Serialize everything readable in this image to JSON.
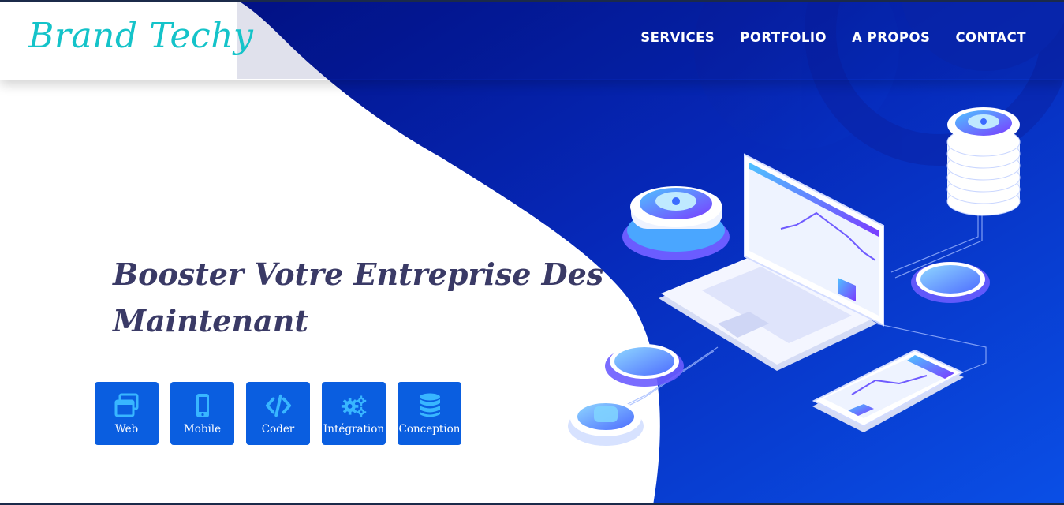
{
  "brand": {
    "logo_text": "Brand Techy",
    "logo_color": "#14c3c9"
  },
  "nav": {
    "items": [
      {
        "label": "SERVICES"
      },
      {
        "label": "PORTFOLIO"
      },
      {
        "label": "A PROPOS"
      },
      {
        "label": "CONTACT"
      }
    ]
  },
  "hero": {
    "title_line1": "Booster Votre Entreprise Des",
    "title_line2": "Maintenant",
    "title_color": "#3a3a66"
  },
  "services": [
    {
      "label": "Web",
      "icon": "windows-icon"
    },
    {
      "label": "Mobile",
      "icon": "mobile-icon"
    },
    {
      "label": "Coder",
      "icon": "code-icon"
    },
    {
      "label": "Intégration",
      "icon": "cogs-icon"
    },
    {
      "label": "Conception",
      "icon": "database-icon"
    }
  ],
  "colors": {
    "hero_blue": "#0a3fd6",
    "hero_blue_dark": "#03138a",
    "button_blue": "#0a5ee0",
    "icon_cyan": "#38b6ff"
  },
  "illustration": {
    "name": "isometric-tech-illustration"
  }
}
